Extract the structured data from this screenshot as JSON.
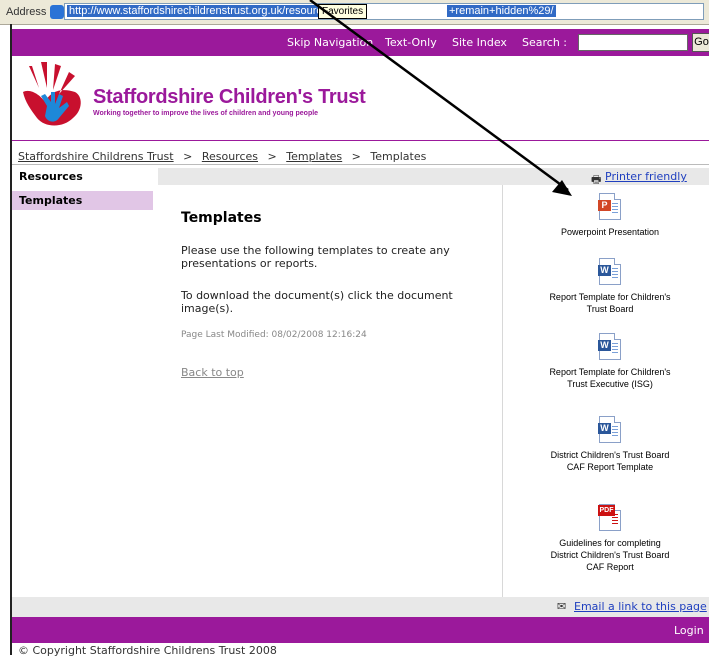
{
  "browser": {
    "address_label": "Address",
    "url": "http://www.staffordshirechildrenstrust.org.uk/resources/temp",
    "url_tail": "+remain+hidden%29/",
    "tooltip": "Favorites"
  },
  "topbar": {
    "skip_navigation": "Skip Navigation",
    "text_only": "Text-Only",
    "site_index": "Site Index",
    "search_label": "Search :",
    "go_label": "Go"
  },
  "header": {
    "logo_title": "Staffordshire Children's Trust",
    "logo_tagline": "Working together to improve the lives of children and young people"
  },
  "breadcrumb": {
    "items": [
      "Staffordshire Childrens Trust",
      "Resources",
      "Templates",
      "Templates"
    ],
    "separator": ">"
  },
  "nav": {
    "section": "Resources",
    "active_item": "Templates"
  },
  "content": {
    "printer_friendly": "Printer friendly",
    "title": "Templates",
    "para1": "Please use the following templates to create any presentations or reports.",
    "para2": "To download the document(s) click the document image(s).",
    "modified": "Page Last Modified: 08/02/2008 12:16:24",
    "back_to_top": "Back to top"
  },
  "documents": [
    {
      "label": "Powerpoint Presentation",
      "badge": "P",
      "icon": "powerpoint-icon",
      "color": "#d24726"
    },
    {
      "label": "Report Template for Children's Trust Board",
      "badge": "W",
      "icon": "word-icon",
      "color": "#2b579a"
    },
    {
      "label": "Report Template for Children's Trust Executive (ISG)",
      "badge": "W",
      "icon": "word-icon",
      "color": "#2b579a"
    },
    {
      "label": "District Children's Trust Board CAF Report Template",
      "badge": "W",
      "icon": "word-icon",
      "color": "#2b579a"
    },
    {
      "label": "Guidelines for completing District Children's Trust Board CAF Report",
      "badge": "PDF",
      "icon": "pdf-icon",
      "color": "#cc1111"
    }
  ],
  "footer": {
    "email_link": "Email a link to this page",
    "login": "Login",
    "copyright": "© Copyright Staffordshire Childrens Trust 2008"
  },
  "colors": {
    "brand_purple": "#9b199b",
    "nav_highlight": "#e1c6e6",
    "link_blue": "#1f3fbf"
  }
}
